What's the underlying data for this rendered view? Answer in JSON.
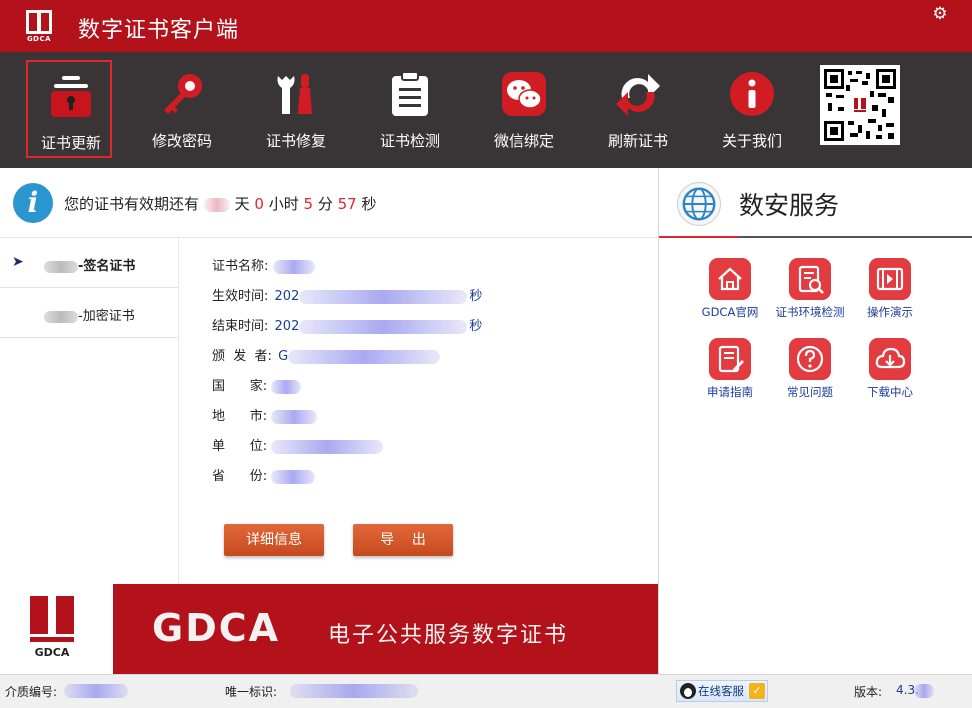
{
  "app": {
    "title": "数字证书客户端",
    "logo_text": "GDCA"
  },
  "toolbar": {
    "items": [
      {
        "label": "证书更新",
        "icon": "lock-refresh-icon",
        "active": true
      },
      {
        "label": "修改密码",
        "icon": "key-icon"
      },
      {
        "label": "证书修复",
        "icon": "wrench-icon"
      },
      {
        "label": "证书检测",
        "icon": "clipboard-icon"
      },
      {
        "label": "微信绑定",
        "icon": "wechat-icon"
      },
      {
        "label": "刷新证书",
        "icon": "refresh-icon"
      },
      {
        "label": "关于我们",
        "icon": "info-icon"
      }
    ]
  },
  "validity": {
    "prefix": "您的证书有效期还有",
    "day_unit": "天",
    "hours": "0",
    "hour_unit": "小时",
    "minutes": "5",
    "minute_unit": "分",
    "seconds": "57",
    "second_unit": "秒"
  },
  "cert_nav": {
    "items": [
      {
        "suffix": "-签名证书",
        "selected": true
      },
      {
        "suffix": "-加密证书",
        "selected": false
      }
    ]
  },
  "cert_detail": {
    "name_label": "证书名称:",
    "start_label": "生效时间:",
    "start_value_prefix": "202",
    "start_value_suffix": "秒",
    "end_label": "结束时间:",
    "end_value_prefix": "202",
    "end_value_suffix": "秒",
    "issuer_label": "颁  发  者:",
    "issuer_value_prefix": "G",
    "country_label": "国      家:",
    "city_label": "地      市:",
    "org_label": "单      位:",
    "province_label": "省      份:"
  },
  "buttons": {
    "details": "详细信息",
    "export": "导    出"
  },
  "banner": {
    "logo_text": "GDCA",
    "title": "GDCA",
    "subtitle": "电子公共服务数字证书"
  },
  "service": {
    "title": "数安服务",
    "items": [
      {
        "label": "GDCA官网",
        "icon": "home-icon"
      },
      {
        "label": "证书环境检测",
        "icon": "doc-search-icon"
      },
      {
        "label": "操作演示",
        "icon": "video-icon"
      },
      {
        "label": "申请指南",
        "icon": "guide-icon"
      },
      {
        "label": "常见问题",
        "icon": "question-icon"
      },
      {
        "label": "下载中心",
        "icon": "download-icon"
      }
    ]
  },
  "status": {
    "media_label": "介质编号:",
    "uid_label": "唯一标识:",
    "kefu": "在线客服",
    "version_label": "版本:",
    "version_value": "4.3."
  }
}
